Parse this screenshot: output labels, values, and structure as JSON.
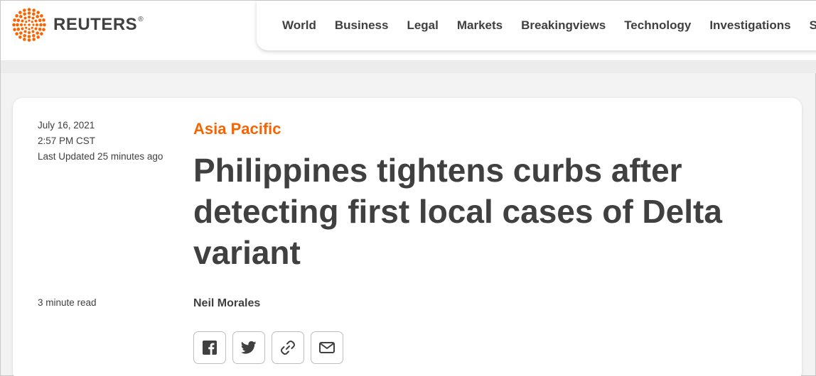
{
  "brand": {
    "name": "REUTERS",
    "mark": "®",
    "accent": "#fa6400"
  },
  "nav": {
    "items": [
      "World",
      "Business",
      "Legal",
      "Markets",
      "Breakingviews",
      "Technology",
      "Investigations",
      "Sports"
    ]
  },
  "article": {
    "date": "July 16, 2021",
    "time": "2:57 PM CST",
    "updated": "Last Updated 25 minutes ago",
    "read_time": "3 minute read",
    "section": "Asia Pacific",
    "headline": "Philippines tightens curbs after detecting first local cases of Delta variant",
    "author": "Neil Morales"
  },
  "share": {
    "icons": [
      "facebook-icon",
      "twitter-icon",
      "link-icon",
      "email-icon"
    ]
  }
}
